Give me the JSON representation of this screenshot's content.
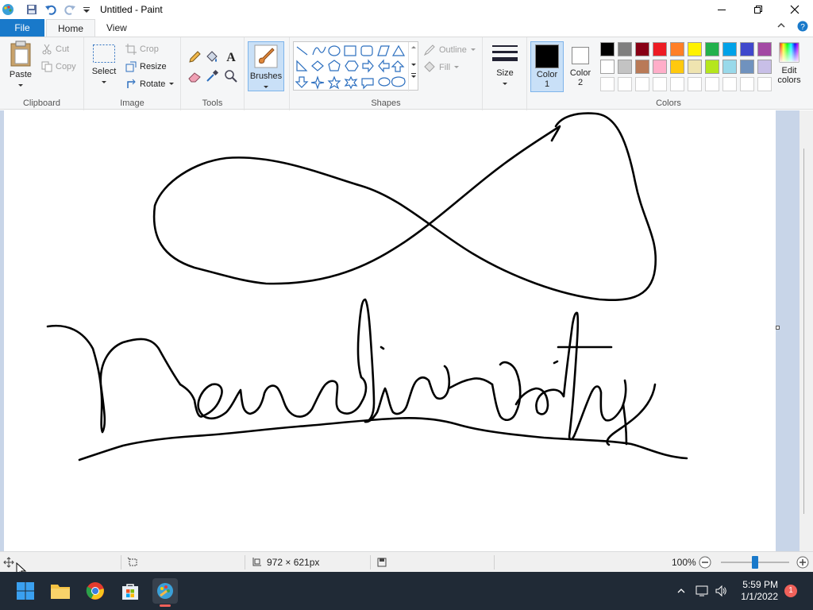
{
  "window": {
    "title": "Untitled - Paint"
  },
  "tabs": {
    "file": "File",
    "home": "Home",
    "view": "View"
  },
  "ribbon": {
    "clipboard": {
      "label": "Clipboard",
      "paste": "Paste",
      "cut": "Cut",
      "copy": "Copy"
    },
    "image": {
      "label": "Image",
      "select": "Select",
      "crop": "Crop",
      "resize": "Resize",
      "rotate": "Rotate"
    },
    "tools": {
      "label": "Tools"
    },
    "brushes": {
      "label": "Brushes"
    },
    "shapes": {
      "label": "Shapes",
      "outline": "Outline",
      "fill": "Fill"
    },
    "size": {
      "label": "Size"
    },
    "color1": {
      "label_line1": "Color",
      "label_line2": "1",
      "value": "#000000"
    },
    "color2": {
      "label_line1": "Color",
      "label_line2": "2",
      "value": "#ffffff"
    },
    "colors": {
      "label": "Colors",
      "edit_line1": "Edit",
      "edit_line2": "colors",
      "row1": [
        "#000000",
        "#7f7f7f",
        "#880015",
        "#ed1c24",
        "#ff7f27",
        "#fff200",
        "#22b14c",
        "#00a2e8",
        "#3f48cc",
        "#a349a4"
      ],
      "row2": [
        "#ffffff",
        "#c3c3c3",
        "#b97a57",
        "#ffaec9",
        "#ffc90e",
        "#efe4b0",
        "#b5e61d",
        "#99d9ea",
        "#7092be",
        "#c8bfe7"
      ]
    }
  },
  "canvas": {
    "size_text": "972 × 621px"
  },
  "status": {
    "zoom": "100%",
    "zoom_fraction": 0.5
  },
  "taskbar": {
    "time": "5:59 PM",
    "date": "1/1/2022",
    "notification_count": "1"
  }
}
